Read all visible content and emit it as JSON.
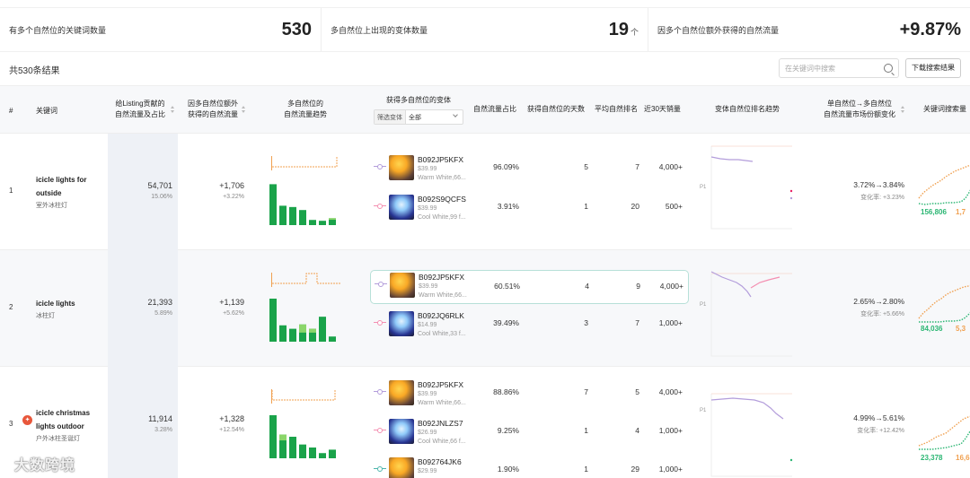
{
  "stats": [
    {
      "label": "有多个自然位的关键词数量",
      "value": "530",
      "unit": ""
    },
    {
      "label": "多自然位上出现的变体数量",
      "value": "19",
      "unit": "个"
    },
    {
      "label": "因多个自然位额外获得的自然流量",
      "value": "+9.87%",
      "unit": ""
    }
  ],
  "results_count": "共530条结果",
  "search": {
    "placeholder": "在关键词中搜索"
  },
  "download_label": "下载搜索结果",
  "columns": {
    "idx": "#",
    "keyword": "关键词",
    "traffic": [
      "给Listing贡献的",
      "自然流量及占比"
    ],
    "extra": [
      "因多自然位额外",
      "获得的自然流量"
    ],
    "trend": [
      "多自然位的",
      "自然流量趋势"
    ],
    "variants": "获得多自然位的变体",
    "filter_label": "筛选变体",
    "filter_value": "全部",
    "share": "自然流量占比",
    "days": "获得自然位的天数",
    "rank": "平均自然排名",
    "sales": "近30天销量",
    "rank_trend": "变体自然位排名趋势",
    "mkt": [
      "单自然位→多自然位",
      "自然流量市场份额变化"
    ],
    "volume": "关键词搜索量"
  },
  "p1_label": "P1",
  "rows": [
    {
      "idx": "1",
      "kw": [
        "icicle lights for",
        "outside"
      ],
      "kw_cn": "室外冰柱灯",
      "traffic": "54,701",
      "traffic_pct": "15.06%",
      "extra": "+1,706",
      "extra_pct": "+3.22%",
      "bars": [
        0.95,
        0.45,
        0.42,
        0.35,
        0.12,
        0.1,
        0.16
      ],
      "bars_light": [
        0,
        0,
        0,
        0,
        0,
        0,
        0.08
      ],
      "variants": [
        {
          "asin": "B092JP5KFX",
          "price": "$39.99",
          "desc": "Warm White,66...",
          "thumb": "warm",
          "line": "purple",
          "share": "96.09%",
          "days": "5",
          "rank": "7",
          "sales": "4,000+"
        },
        {
          "asin": "B092S9QCFS",
          "price": "$39.99",
          "desc": "Cool White,99 f...",
          "thumb": "cool",
          "line": "pink",
          "share": "3.91%",
          "days": "1",
          "rank": "20",
          "sales": "500+"
        }
      ],
      "mkt": "3.72%→3.84%",
      "mkt_change": "变化率: +3.23%",
      "vol_a": "156,806",
      "vol_b": "1,7"
    },
    {
      "idx": "2",
      "kw": [
        "icicle lights"
      ],
      "kw_cn": "冰柱灯",
      "traffic": "21,393",
      "traffic_pct": "5.89%",
      "extra": "+1,139",
      "extra_pct": "+5.62%",
      "bars": [
        1.0,
        0.38,
        0.3,
        0.4,
        0.3,
        0.58,
        0.12
      ],
      "bars_light": [
        0,
        0,
        0,
        0.42,
        0.2,
        0,
        0
      ],
      "variants": [
        {
          "asin": "B092JP5KFX",
          "price": "$39.99",
          "desc": "Warm White,66...",
          "thumb": "warm",
          "line": "purple",
          "share": "60.51%",
          "days": "4",
          "rank": "9",
          "sales": "4,000+"
        },
        {
          "asin": "B092JQ6RLK",
          "price": "$14.99",
          "desc": "Cool White,33 f...",
          "thumb": "cool",
          "line": "pink",
          "share": "39.49%",
          "days": "3",
          "rank": "7",
          "sales": "1,000+"
        }
      ],
      "mkt": "2.65%→2.80%",
      "mkt_change": "变化率: +5.66%",
      "vol_a": "84,036",
      "vol_b": "5,3"
    },
    {
      "idx": "3",
      "kw": [
        "icicle christmas",
        "lights outdoor"
      ],
      "kw_cn": "户外冰柱圣诞灯",
      "traffic": "11,914",
      "traffic_pct": "3.28%",
      "extra": "+1,328",
      "extra_pct": "+12.54%",
      "bars": [
        1.0,
        0.55,
        0.5,
        0.32,
        0.25,
        0.12,
        0.2
      ],
      "bars_light": [
        0,
        0.3,
        0,
        0,
        0,
        0,
        0
      ],
      "variants": [
        {
          "asin": "B092JP5KFX",
          "price": "$39.99",
          "desc": "Warm White,66...",
          "thumb": "warm",
          "line": "purple",
          "share": "88.86%",
          "days": "7",
          "rank": "5",
          "sales": "4,000+"
        },
        {
          "asin": "B092JNLZS7",
          "price": "$26.99",
          "desc": "Cool White,66 f...",
          "thumb": "cool",
          "line": "pink",
          "share": "9.25%",
          "days": "1",
          "rank": "4",
          "sales": "1,000+"
        },
        {
          "asin": "B092764JK6",
          "price": "$29.99",
          "desc": "",
          "thumb": "warm",
          "line": "teal",
          "share": "1.90%",
          "days": "1",
          "rank": "29",
          "sales": "1,000+"
        }
      ],
      "mkt": "4.99%→5.61%",
      "mkt_change": "变化率: +12.42%",
      "vol_a": "23,378",
      "vol_b": "16,6"
    }
  ],
  "watermark": "大数跨境",
  "colors": {
    "green": "#1aa34a",
    "light_green": "#8bd66a",
    "orange": "#f0a050",
    "purple": "#b39ddb",
    "pink": "#f48fb1"
  }
}
